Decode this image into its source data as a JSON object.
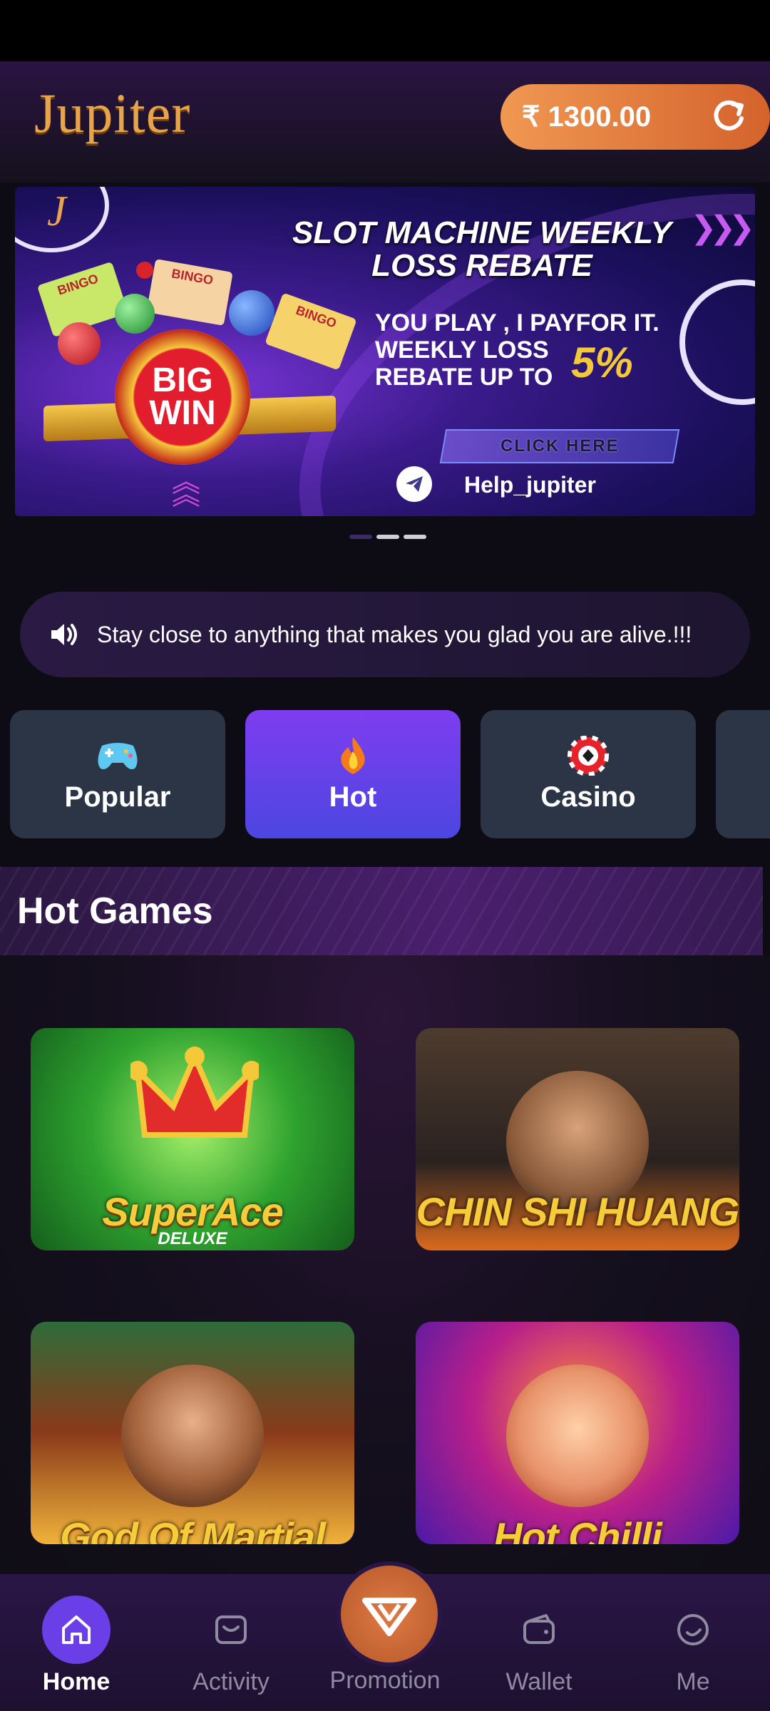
{
  "header": {
    "logo_text": "Jupiter",
    "balance": "₹ 1300.00"
  },
  "banner": {
    "corner_letter": "J",
    "title_line1": "SLOT MACHINE WEEKLY",
    "title_line2": "LOSS REBATE",
    "body_line1": "YOU PLAY , I PAYFOR IT.",
    "body_line2": "WEEKLY LOSS",
    "body_line3": "REBATE UP TO",
    "percent": "5%",
    "cta": "CLICK HERE",
    "contact": "Help_jupiter",
    "bigwin_line1": "BIG",
    "bigwin_line2": "WIN",
    "bingo_label": "BINGO"
  },
  "carousel": {
    "total": 3,
    "active": 1
  },
  "notice": {
    "text": "Stay close to anything that makes you glad you are alive.!!!"
  },
  "categories": [
    {
      "label": "Popular",
      "icon": "gamepad-icon",
      "active": false
    },
    {
      "label": "Hot",
      "icon": "fire-icon",
      "active": true
    },
    {
      "label": "Casino",
      "icon": "poker-chip-icon",
      "active": false
    },
    {
      "label": "",
      "icon": "",
      "active": false
    }
  ],
  "section": {
    "title": "Hot Games"
  },
  "games": [
    {
      "title": "SuperAce",
      "subtitle": "DELUXE"
    },
    {
      "title": "CHIN SHI HUANG"
    },
    {
      "title": "God Of Martial"
    },
    {
      "title": "Hot Chilli"
    }
  ],
  "tabbar": {
    "home": "Home",
    "activity": "Activity",
    "promotion": "Promotion",
    "wallet": "Wallet",
    "me": "Me"
  },
  "colors": {
    "accent": "#6b3fe8",
    "balance_pill": "#e4773c",
    "active_category": "#6a3fea",
    "promo_gold": "#f4c938"
  }
}
